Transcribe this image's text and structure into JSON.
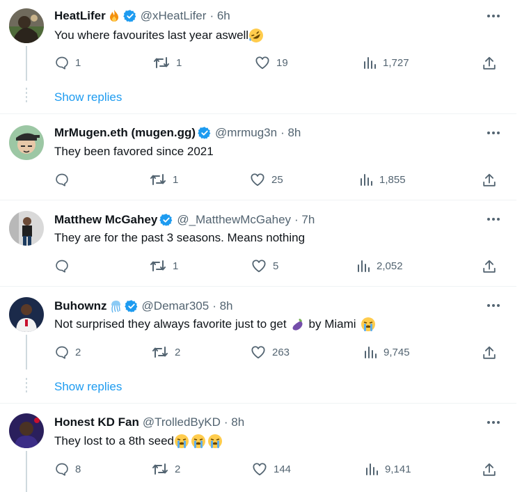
{
  "colors": {
    "accent": "#1d9bf0",
    "muted": "#536471",
    "text": "#0f1419",
    "divider": "#eff3f4"
  },
  "show_replies_label": "Show replies",
  "tweets": [
    {
      "name": "HeatLifer",
      "name_emoji": "fire",
      "handle": "@xHeatLifer",
      "time": "· 6h",
      "text": "You where favourites last year aswell",
      "text_emoji": "rofl",
      "replies": "1",
      "retweets": "1",
      "likes": "19",
      "views": "1,727"
    },
    {
      "name": "MrMugen.eth (mugen.gg)",
      "handle": "@mrmug3n",
      "time": "· 8h",
      "text": "They been favored since 2021",
      "replies": "",
      "retweets": "1",
      "likes": "25",
      "views": "1,855"
    },
    {
      "name": "Matthew McGahey",
      "handle": "@_MatthewMcGahey",
      "time": "· 7h",
      "text": "They are for the past 3 seasons. Means nothing",
      "replies": "",
      "retweets": "1",
      "likes": "5",
      "views": "2,052"
    },
    {
      "name": "Buhownz",
      "name_emoji": "jellyfish",
      "handle": "@Demar305",
      "time": "· 8h",
      "text_a": "Not surprised they always favorite just to get",
      "text_b": "by Miami",
      "replies": "2",
      "retweets": "2",
      "likes": "263",
      "views": "9,745"
    },
    {
      "name": "Honest KD Fan",
      "handle": "@TrolledByKD",
      "time": "· 8h",
      "text": "They lost to a 8th seed",
      "replies": "8",
      "retweets": "2",
      "likes": "144",
      "views": "9,141"
    }
  ]
}
